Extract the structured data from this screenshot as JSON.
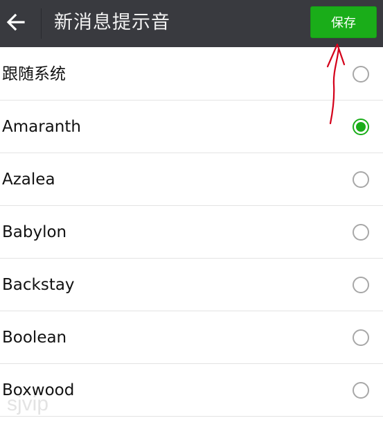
{
  "header": {
    "back_icon": "arrow-left-icon",
    "title": "新消息提示音",
    "save_label": "保存"
  },
  "colors": {
    "topbar_bg": "#393a3f",
    "accent_green": "#1aad19",
    "annotation_red": "#d4001a"
  },
  "sound_list": {
    "selected": "Amaranth",
    "items": [
      {
        "label": "跟随系统",
        "checked": false
      },
      {
        "label": "Amaranth",
        "checked": true
      },
      {
        "label": "Azalea",
        "checked": false
      },
      {
        "label": "Babylon",
        "checked": false
      },
      {
        "label": "Backstay",
        "checked": false
      },
      {
        "label": "Boolean",
        "checked": false
      },
      {
        "label": "Boxwood",
        "checked": false
      }
    ]
  },
  "watermark": "sjvip"
}
